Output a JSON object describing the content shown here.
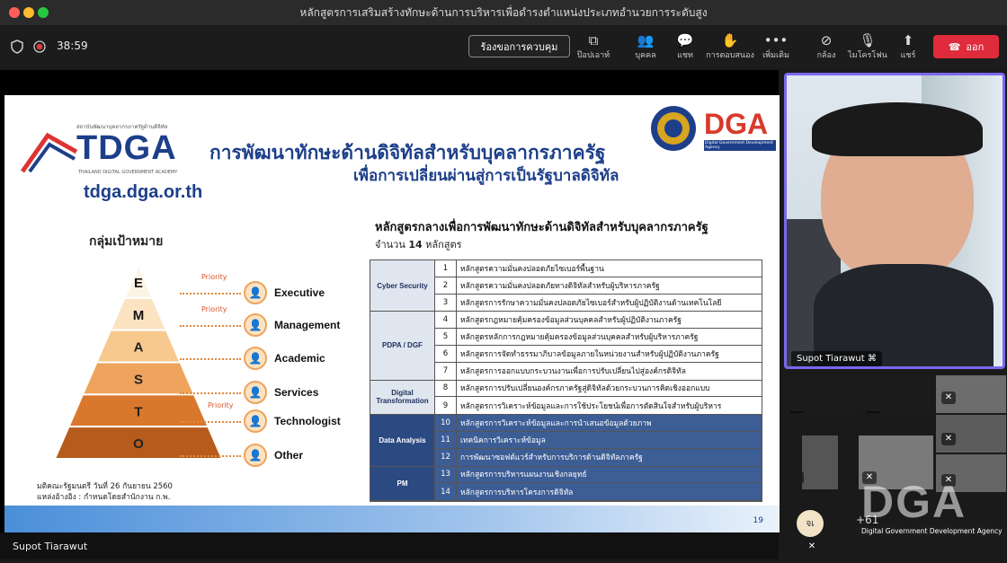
{
  "window": {
    "title": "หลักสูตรการเสริมสร้างทักษะด้านการบริหารเพื่อดำรงตำแหน่งประเภทอำนวยการระดับสูง"
  },
  "toolbar": {
    "timer": "38:59",
    "request_control": "ร้องขอการควบคุม",
    "popout": "ป๊อปเอาท์",
    "people": "บุคคล",
    "chat": "แชท",
    "reactions": "การตอบสนอง",
    "more": "เพิ่มเติม",
    "camera": "กล้อง",
    "mic": "ไมโครโฟน",
    "share": "แชร์",
    "leave": "ออก"
  },
  "colors": {
    "leave": "#e02b3c",
    "active_border": "#7b68ee",
    "toolbar_bg": "#1c1c1c"
  },
  "slide": {
    "logo_small": "สถาบันพัฒนาบุคลากรภาครัฐด้านดิจิทัล",
    "logo_text": "TDGA",
    "logo_sub": "THAILAND DIGITAL GOVERNMENT ACADEMY",
    "url": "tdga.dga.or.th",
    "dga_logo": "DGA",
    "dga_sub": "Digital Government Development Agency",
    "title1": "การพัฒนาทักษะด้านดิจิทัลสำหรับบุคลากรภาครัฐ",
    "title2": "เพื่อการเปลี่ยนผ่านสู่การเป็นรัฐบาลดิจิทัล",
    "target_heading": "กลุ่มเป้าหมาย",
    "pyramid": [
      "E",
      "M",
      "A",
      "S",
      "T",
      "O"
    ],
    "priority_label": "Priority",
    "groups": [
      "Executive",
      "Management",
      "Academic",
      "Services",
      "Technologist",
      "Other"
    ],
    "note1": "มติคณะรัฐมนตรี วันที่ 26 กันยายน 2560",
    "note2": "แหล่งอ้างอิง : กำหนดโดยสำนักงาน ก.พ.",
    "course_heading": "หลักสูตรกลางเพื่อการพัฒนาทักษะด้านดิจิทัลสำหรับบุคลากรภาครัฐ",
    "course_count_pre": "จำนวน",
    "course_count": "14",
    "course_count_post": "หลักสูตร",
    "categories": [
      {
        "name": "Cyber Security",
        "rows": [
          [
            "1",
            "หลักสูตรความมั่นคงปลอดภัยไซเบอร์พื้นฐาน"
          ],
          [
            "2",
            "หลักสูตรความมั่นคงปลอดภัยทางดิจิทัลสำหรับผู้บริหารภาครัฐ"
          ],
          [
            "3",
            "หลักสูตรการรักษาความมั่นคงปลอดภัยไซเบอร์สำหรับผู้ปฏิบัติงานด้านเทคโนโลยี"
          ]
        ]
      },
      {
        "name": "PDPA / DGF",
        "rows": [
          [
            "4",
            "หลักสูตรกฎหมายคุ้มครองข้อมูลส่วนบุคคลสำหรับผู้ปฏิบัติงานภาครัฐ"
          ],
          [
            "5",
            "หลักสูตรหลักการกฎหมายคุ้มครองข้อมูลส่วนบุคคลสำหรับผู้บริหารภาครัฐ"
          ],
          [
            "6",
            "หลักสูตรการจัดทำธรรมาภิบาลข้อมูลภายในหน่วยงานสำหรับผู้ปฏิบัติงานภาครัฐ"
          ],
          [
            "7",
            "หลักสูตรการออกแบบกระบวนงานเพื่อการปรับเปลี่ยนไปสู่องค์กรดิจิทัล"
          ]
        ]
      },
      {
        "name": "Digital Transformation",
        "rows": [
          [
            "8",
            "หลักสูตรการปรับเปลี่ยนองค์กรภาครัฐสู่ดิจิทัลด้วยกระบวนการคิดเชิงออกแบบ"
          ],
          [
            "9",
            "หลักสูตรการวิเคราะห์ข้อมูลและการใช้ประโยชน์เพื่อการตัดสินใจสำหรับผู้บริหาร"
          ]
        ]
      },
      {
        "name": "Data Analysis",
        "rows": [
          [
            "10",
            "หลักสูตรการวิเคราะห์ข้อมูลและการนำเสนอข้อมูลด้วยภาพ"
          ],
          [
            "11",
            "เทคนิคการวิเคราะห์ข้อมูล"
          ],
          [
            "12",
            "การพัฒนาซอฟต์แวร์สำหรับการบริการด้านดิจิทัลภาครัฐ"
          ]
        ]
      },
      {
        "name": "PM",
        "rows": [
          [
            "13",
            "หลักสูตรการบริหารแผนงานเชิงกลยุทธ์"
          ],
          [
            "14",
            "หลักสูตรการบริหารโครงการดิจิทัล"
          ]
        ]
      }
    ],
    "page": "19"
  },
  "speaker": {
    "name": "Supot Tiarawut"
  },
  "camera_tile": {
    "name": "Supot Tiarawut"
  },
  "participants": {
    "avatar_initial": "จเ",
    "overflow": "+61"
  },
  "watermark": {
    "text": "DGA",
    "sub": "Digital Government Development Agency"
  }
}
